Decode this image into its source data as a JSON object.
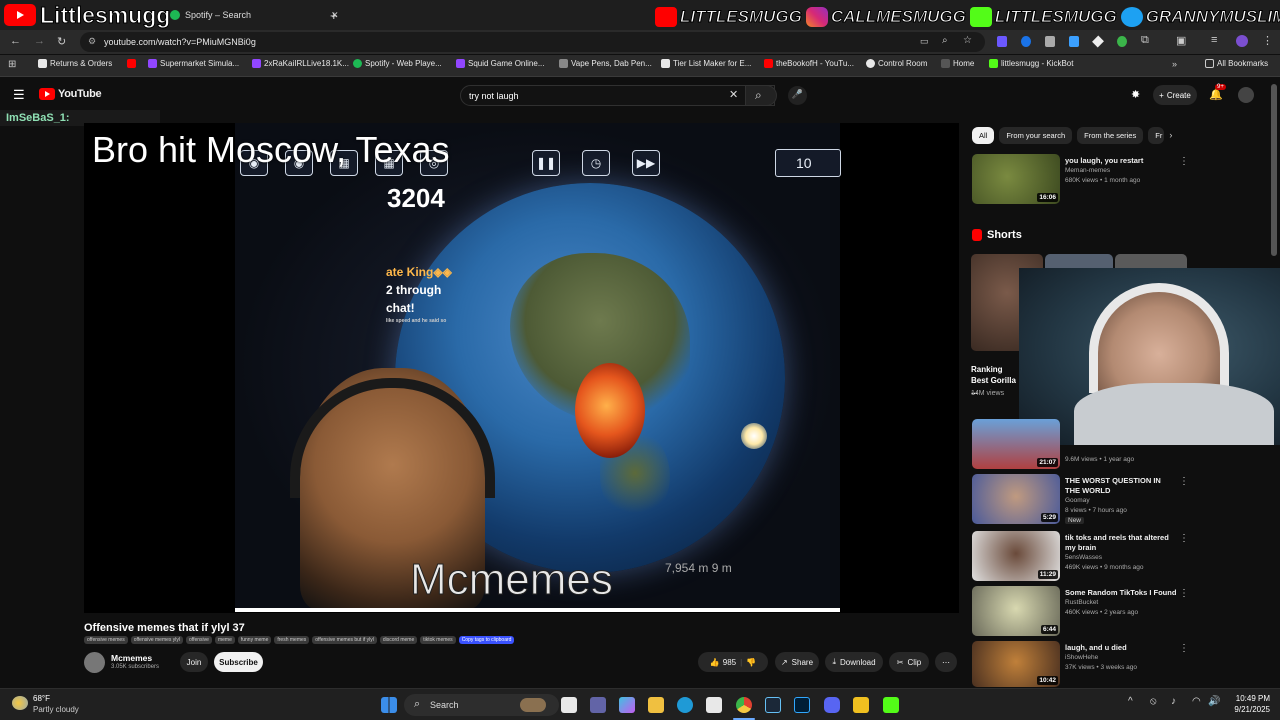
{
  "browser": {
    "tabs": [
      {
        "label": "Spotify – Search"
      }
    ],
    "url": "youtube.com/watch?v=PMiuMGNBi0g",
    "bookmarks": [
      {
        "label": "Returns & Orders",
        "color": "#e8e8e8"
      },
      {
        "label": "",
        "color": "#ff0000"
      },
      {
        "label": "Supermarket Simula...",
        "color": "#9146ff"
      },
      {
        "label": "2xRaKaiIRLLive18.1K...",
        "color": "#9146ff"
      },
      {
        "label": "Spotify - Web Playe...",
        "color": "#1db954"
      },
      {
        "label": "Squid Game Online...",
        "color": "#9146ff"
      },
      {
        "label": "Vape Pens, Dab Pen...",
        "color": "#888888"
      },
      {
        "label": "Tier List Maker for E...",
        "color": "#e8e8e8"
      },
      {
        "label": "theBookofH - YouTu...",
        "color": "#ff0000"
      },
      {
        "label": "Control Room",
        "color": "#e8e8e8"
      },
      {
        "label": "Home",
        "color": "#555555"
      },
      {
        "label": "littlesmugg - KickBot",
        "color": "#53fc18"
      }
    ],
    "all_bookmarks_label": "All Bookmarks"
  },
  "stream_overlay": {
    "channel_name": "Littlesmugg",
    "socials": [
      {
        "handle": "LITTLESMUGG",
        "color": "#ff0000"
      },
      {
        "handle": "CALLMESMUGG",
        "color": "#d62976"
      },
      {
        "handle": "LITTLESMUGG",
        "color": "#53fc18"
      },
      {
        "handle": "GRANNYMUSLIM",
        "color": "#1da1f2"
      }
    ],
    "chat_user": "ImSeBaS_1:"
  },
  "youtube": {
    "logo_text": "YouTube",
    "search_query": "try not laugh",
    "create_label": "Create",
    "notifications_badge": "9+",
    "video": {
      "overlay_title": "Bro hit Moscow, Texas",
      "score": "3204",
      "chat_lines": [
        "ate King◈◈",
        "2 through",
        "chat!"
      ],
      "chat_small": "like speed and he said so",
      "counter": "10",
      "watermark": "Mcmemes",
      "readout": "7,954 m   9 m"
    },
    "title": "Offensive memes that if ylyl 37",
    "tags": [
      "offensive memes",
      "offensive memes ylyl",
      "offensive",
      "meme",
      "funny meme",
      "fresh memes",
      "offensive memes but if ylyl",
      "discord meme",
      "tiktok memes"
    ],
    "copy_tag": "Copy tags to clipboard",
    "channel": {
      "name": "Mcmemes",
      "subscribers": "3.05K subscribers"
    },
    "join_label": "Join",
    "subscribe_label": "Subscribe",
    "likes": "985",
    "share_label": "Share",
    "download_label": "Download",
    "clip_label": "Clip",
    "chips": [
      "All",
      "From your search",
      "From the series",
      "Fr"
    ],
    "shorts_label": "Shorts",
    "shorts": [
      {
        "title": "Ranking Best Gorilla ...",
        "views": "14M views"
      }
    ],
    "related": [
      {
        "title": "you laugh, you restart",
        "channel": "Meman-memes",
        "meta": "680K views • 1 month ago",
        "duration": "16:06",
        "thumb_color": "#6b7a3a"
      },
      {
        "title": "",
        "channel": "",
        "meta": "9.6M views • 1 year ago",
        "duration": "21:07",
        "thumb_color": "#b04040"
      },
      {
        "title": "THE WORST QUESTION IN THE WORLD",
        "channel": "Goomay",
        "meta": "8 views • 7 hours ago",
        "duration": "5:29",
        "badge": "New",
        "thumb_color": "#4a5a9a"
      },
      {
        "title": "tik toks and reels that altered my brain",
        "channel": "5ensWasses",
        "meta": "469K views • 9 months ago",
        "duration": "11:29",
        "thumb_color": "#d8d8d8"
      },
      {
        "title": "Some Random TikToks I Found",
        "channel": "RustBucket",
        "meta": "460K views • 2 years ago",
        "duration": "6:44",
        "thumb_color": "#8a8a6a"
      },
      {
        "title": "laugh, and u died",
        "channel": "iShowHehe",
        "meta": "37K views • 3 weeks ago",
        "duration": "10:42",
        "thumb_color": "#c0803a"
      }
    ]
  },
  "taskbar": {
    "weather_temp": "68°F",
    "weather_desc": "Partly cloudy",
    "search_label": "Search",
    "time": "10:49 PM",
    "date": "9/21/2025",
    "apps": [
      {
        "name": "windows-icon",
        "color": "#3b8eea"
      },
      {
        "name": "files-icon",
        "color": "#ffffff"
      },
      {
        "name": "teams-icon",
        "color": "#6264a7"
      },
      {
        "name": "copilot-icon",
        "color": "#3fc1e0"
      },
      {
        "name": "folder-icon",
        "color": "#f0c040"
      },
      {
        "name": "edge-icon",
        "color": "#1f9ad6"
      },
      {
        "name": "store-icon",
        "color": "#e8e8e8"
      },
      {
        "name": "chrome-icon",
        "color": "#e04030"
      },
      {
        "name": "steam-icon",
        "color": "#1b2838"
      },
      {
        "name": "photoshop-icon",
        "color": "#001e36"
      },
      {
        "name": "discord-icon",
        "color": "#5865f2"
      },
      {
        "name": "app-icon",
        "color": "#f0c020"
      },
      {
        "name": "kick-icon",
        "color": "#53fc18"
      }
    ]
  }
}
